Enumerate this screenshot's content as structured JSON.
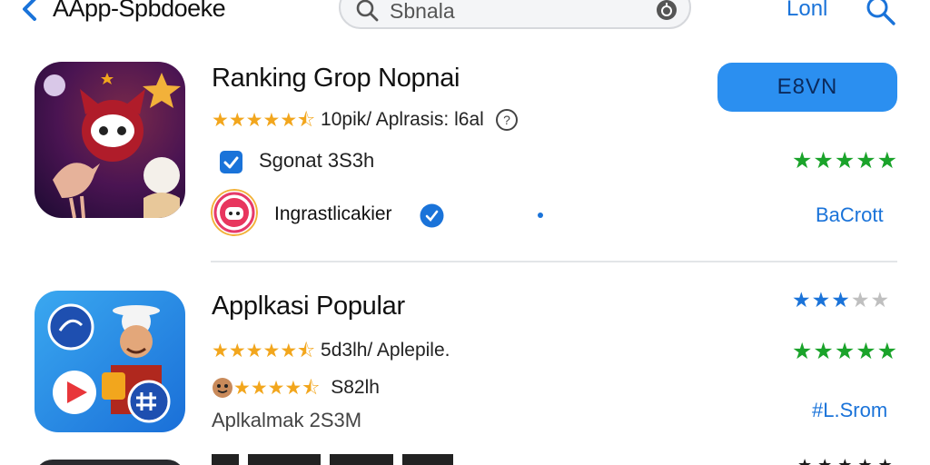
{
  "header": {
    "title": "AApp-Spbdoeke",
    "search_placeholder": "Sbnala",
    "link": "Lonl"
  },
  "apps": [
    {
      "name": "Ranking Grop Nopnai",
      "rating_stars": 4.5,
      "meta": "10pik/ Aplrasis: l6al",
      "info_icon": "info-icon",
      "button_label": "E8VN",
      "checkbox_checked": true,
      "check_label": "Sgonat 3S3h",
      "right_rating_stars": 5,
      "developer": "Ingrastlicakier",
      "developer_verified": true,
      "right_link": "BaCrott"
    },
    {
      "name": "Applkasi Popular",
      "right_rating_top": 3.5,
      "rating_stars": 4.5,
      "meta": "5d3lh/ Aplepile.",
      "right_rating_mid": 5,
      "emoji_rating_stars": 4.5,
      "emoji_meta": "S82lh",
      "sub_text": "Aplkalmak 2S3M",
      "right_link": "#L.Srom"
    }
  ],
  "colors": {
    "accent_blue": "#1a73d9",
    "button_blue": "#2b8ff0",
    "star_gold": "#f2a61d",
    "star_green": "#1aa32a"
  }
}
